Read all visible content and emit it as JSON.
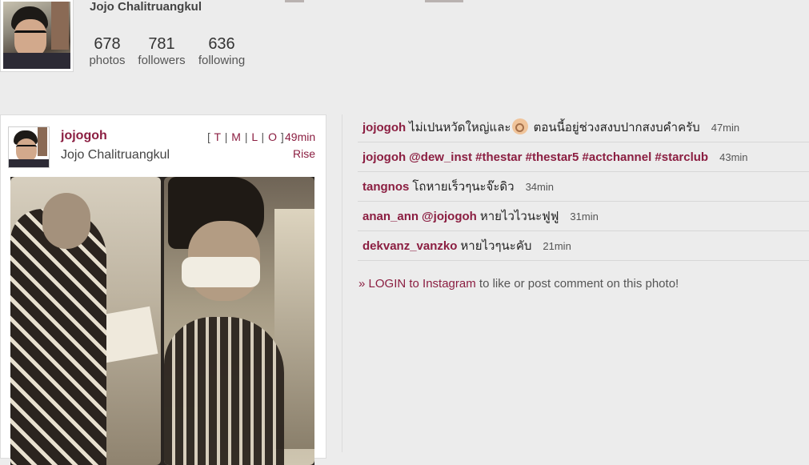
{
  "profile": {
    "name": "Jojo Chalitruangkul",
    "stats": [
      {
        "value": "678",
        "label": "photos"
      },
      {
        "value": "781",
        "label": "followers"
      },
      {
        "value": "636",
        "label": "following"
      }
    ]
  },
  "post": {
    "username": "jojogoh",
    "full_name": "Jojo Chalitruangkul",
    "links": {
      "open": "[",
      "t": "T",
      "sep": "|",
      "m": "M",
      "l": "L",
      "o": "O",
      "close": "]"
    },
    "time": "49min",
    "filter": "Rise"
  },
  "comments": [
    {
      "user": "jojogoh",
      "text_before": "ไม่เปนหวัดใหญ่และ",
      "emoji": "ok-hand-icon",
      "text_after": "ตอนนี้อยู่ช่วงสงบปากสงบคำครับ",
      "time": "47min"
    },
    {
      "user": "jojogoh",
      "text": "@dew_inst #thestar #thestar5 #actchannel #starclub",
      "time": "43min"
    },
    {
      "user": "tangnos",
      "text": "โถหายเร็วๆนะจ๊ะดิว",
      "time": "34min"
    },
    {
      "user": "anan_ann",
      "text_link": "@jojogoh",
      "text": "หายไวไวนะฟูฟู",
      "time": "31min"
    },
    {
      "user": "dekvanz_vanzko",
      "text": "หายไวๆนะคับ",
      "time": "21min"
    }
  ],
  "login": {
    "raquo": "»",
    "link_text": "LOGIN to Instagram",
    "rest": "to like or post comment on this photo!"
  },
  "colors": {
    "accent": "#8b1e41",
    "background": "#ececec"
  }
}
